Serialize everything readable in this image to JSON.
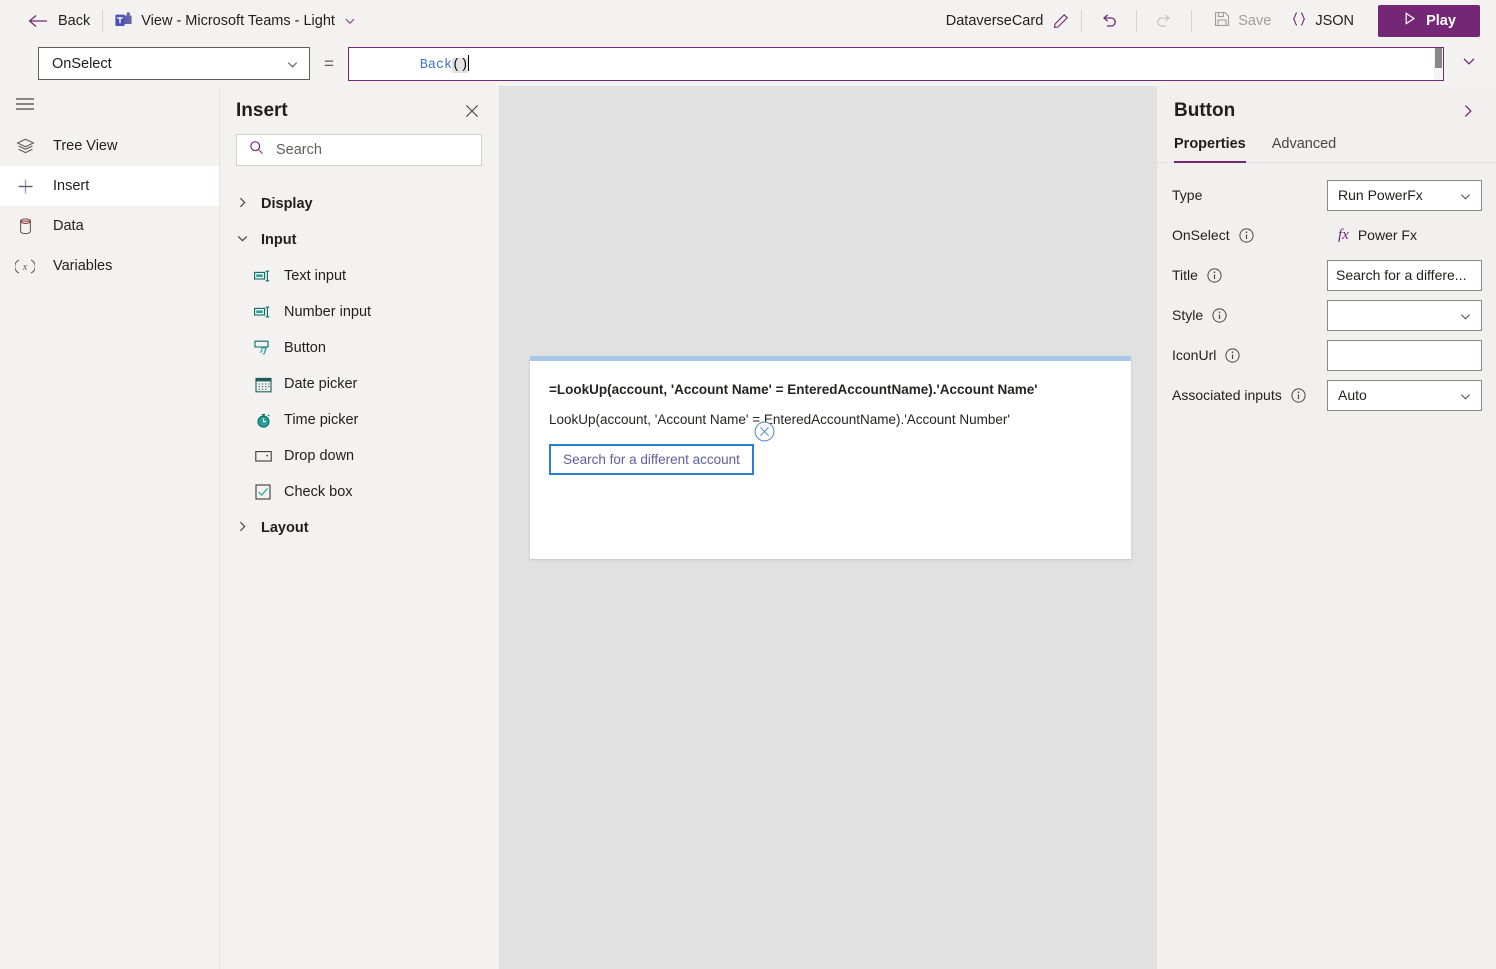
{
  "topbar": {
    "back_label": "Back",
    "back_icon": "arrow-left-icon",
    "app_icon": "microsoft-teams-icon",
    "app_title": "View - Microsoft Teams - Light",
    "app_title_chevron": "chevron-down-icon",
    "card_name": "DataverseCard",
    "edit_icon": "pencil-icon",
    "undo_icon": "undo-icon",
    "redo_icon": "redo-icon",
    "save_icon": "save-disk-icon",
    "save_label": "Save",
    "json_icon": "curly-braces-icon",
    "json_label": "JSON",
    "play_icon": "play-triangle-icon",
    "play_label": "Play",
    "accent_color": "#742774"
  },
  "formula_bar": {
    "property_selected": "OnSelect",
    "property_chevron": "chevron-down-icon",
    "equals": "=",
    "formula_function": "Back",
    "formula_parens": "()",
    "expand_icon": "chevron-down-icon",
    "border_color": "#742774"
  },
  "rail": {
    "menu_icon": "hamburger-menu-icon",
    "items": [
      {
        "label": "Tree View",
        "icon": "layers-icon",
        "selected": false
      },
      {
        "label": "Insert",
        "icon": "plus-icon",
        "selected": true
      },
      {
        "label": "Data",
        "icon": "database-icon",
        "selected": false
      },
      {
        "label": "Variables",
        "icon": "variables-x-icon",
        "selected": false
      }
    ]
  },
  "insert_panel": {
    "title": "Insert",
    "close_icon": "close-icon",
    "search": {
      "icon": "search-icon",
      "placeholder": "Search",
      "value": ""
    },
    "categories": [
      {
        "label": "Display",
        "expanded": false,
        "chevron": "chevron-right-icon",
        "items": []
      },
      {
        "label": "Input",
        "expanded": true,
        "chevron": "chevron-down-icon",
        "items": [
          {
            "label": "Text input",
            "icon": "text-input-icon"
          },
          {
            "label": "Number input",
            "icon": "number-input-icon"
          },
          {
            "label": "Button",
            "icon": "button-icon"
          },
          {
            "label": "Date picker",
            "icon": "calendar-icon"
          },
          {
            "label": "Time picker",
            "icon": "clock-icon"
          },
          {
            "label": "Drop down",
            "icon": "dropdown-icon"
          },
          {
            "label": "Check box",
            "icon": "checkbox-icon"
          }
        ]
      },
      {
        "label": "Layout",
        "expanded": false,
        "chevron": "chevron-right-icon",
        "items": []
      }
    ]
  },
  "canvas": {
    "background_color": "#e1e1e1",
    "card": {
      "accent_color": "#a8c8e9",
      "line1": "=LookUp(account, 'Account Name' = EnteredAccountName).'Account Name'",
      "line2": "LookUp(account, 'Account Name' = EnteredAccountName).'Account Number'",
      "button_label": "Search for a different account",
      "button_border_color": "#2b7cd3",
      "delete_icon": "circle-x-delete-icon"
    }
  },
  "properties_panel": {
    "title": "Button",
    "collapse_icon": "chevron-right-icon",
    "tabs": [
      {
        "label": "Properties",
        "active": true
      },
      {
        "label": "Advanced",
        "active": false
      }
    ],
    "rows": [
      {
        "label": "Type",
        "has_info": false,
        "control": "select",
        "value": "Run PowerFx"
      },
      {
        "label": "OnSelect",
        "has_info": true,
        "control": "fx",
        "value": "Power Fx",
        "fx_glyph": "fx"
      },
      {
        "label": "Title",
        "has_info": true,
        "control": "text",
        "value": "Search for a differe..."
      },
      {
        "label": "Style",
        "has_info": true,
        "control": "select",
        "value": ""
      },
      {
        "label": "IconUrl",
        "has_info": true,
        "control": "text",
        "value": ""
      },
      {
        "label": "Associated inputs",
        "has_info": true,
        "control": "select",
        "value": "Auto"
      }
    ],
    "active_tab_color": "#742774"
  }
}
